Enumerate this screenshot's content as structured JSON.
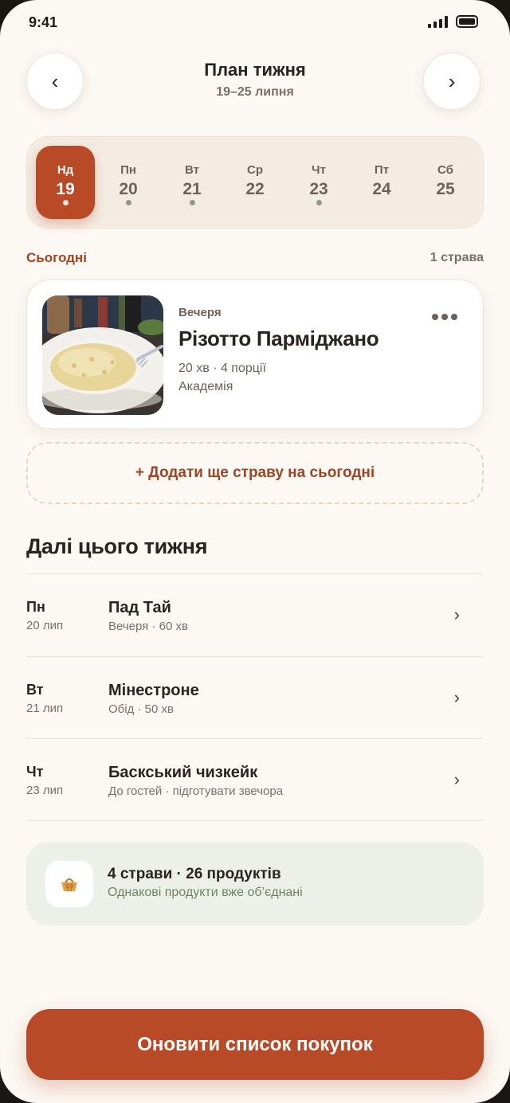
{
  "status_bar": {
    "time": "9:41",
    "icons": [
      "signal-icon",
      "battery-icon"
    ]
  },
  "header": {
    "title": "План тижня",
    "subtitle": "19–25 липня",
    "prev_icon": "‹",
    "next_icon": "›"
  },
  "week": {
    "days": [
      {
        "name": "Нд",
        "num": "19",
        "active": true,
        "has_meal": true
      },
      {
        "name": "Пн",
        "num": "20",
        "active": false,
        "has_meal": true
      },
      {
        "name": "Вт",
        "num": "21",
        "active": false,
        "has_meal": true
      },
      {
        "name": "Ср",
        "num": "22",
        "active": false,
        "has_meal": false
      },
      {
        "name": "Чт",
        "num": "23",
        "active": false,
        "has_meal": true
      },
      {
        "name": "Пт",
        "num": "24",
        "active": false,
        "has_meal": false
      },
      {
        "name": "Сб",
        "num": "25",
        "active": false,
        "has_meal": false
      }
    ]
  },
  "today": {
    "label": "Сьогодні",
    "count": "1 страва",
    "meal": {
      "kind": "Вечеря",
      "name": "Різотто Парміджано",
      "meta": "20 хв · 4 порції",
      "source": "Академія"
    },
    "add_label": "+ Додати ще страву на сьогодні"
  },
  "later": {
    "title": "Далі цього тижня",
    "items": [
      {
        "day": "Пн",
        "date": "20 лип",
        "name": "Пад Тай",
        "meta": "Вечеря · 60 хв"
      },
      {
        "day": "Вт",
        "date": "21 лип",
        "name": "Мінестроне",
        "meta": "Обід · 50 хв"
      },
      {
        "day": "Чт",
        "date": "23 лип",
        "name": "Баскський чизкейк",
        "meta": "До гостей · підготувати звечора"
      }
    ],
    "chevron": "›"
  },
  "summary": {
    "title": "4 страви · 26 продуктів",
    "subtitle": "Однакові продукти вже об’єднані",
    "icon": "basket-icon"
  },
  "cta": {
    "label": "Оновити список покупок"
  },
  "colors": {
    "accent": "#b84a28",
    "accent_text": "#9d4524",
    "background": "#fcf8f3",
    "sage": "#8a9e82"
  }
}
